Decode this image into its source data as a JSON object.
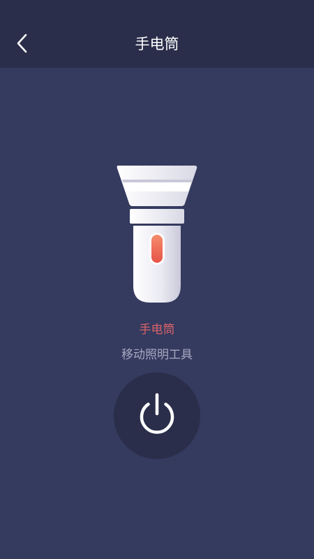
{
  "header": {
    "title": "手电筒",
    "back_icon": "chevron-left-icon"
  },
  "main": {
    "illustration_icon": "flashlight-icon",
    "app_name": "手电筒",
    "description": "移动照明工具",
    "power_icon": "power-icon"
  },
  "colors": {
    "background": "#353a5f",
    "topbar": "#2a2e4a",
    "accent": "#e3505a",
    "app_name_text": "#d9646a",
    "description_text": "#a9aac2",
    "power_button_bg": "#2a2e4a"
  }
}
